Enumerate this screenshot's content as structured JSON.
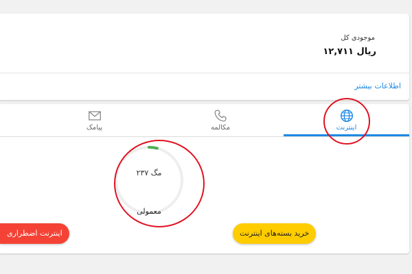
{
  "balance": {
    "label": "موجودی کل",
    "value": "۱۲,۷۱۱ ریال",
    "more_link": "اطلاعات بیشتر"
  },
  "tabs": [
    {
      "label": "اینترنت",
      "icon": "globe-icon",
      "active": true
    },
    {
      "label": "مکالمه",
      "icon": "phone-icon",
      "active": false
    },
    {
      "label": "پیامک",
      "icon": "envelope-icon",
      "active": false
    }
  ],
  "usage": {
    "amount_text": "۲۳۷ مگ",
    "caption": "معمولی",
    "remaining_fraction": 0.04
  },
  "buttons": {
    "buy": "خرید بسته‌های اینترنت",
    "emergency": "اینترنت اضطراری"
  },
  "colors": {
    "accent": "#1e88e5",
    "gauge_fill": "#4caf50",
    "buy_button": "#ffcc00",
    "emergency_button": "#f44336",
    "annotation": "#e01020"
  }
}
